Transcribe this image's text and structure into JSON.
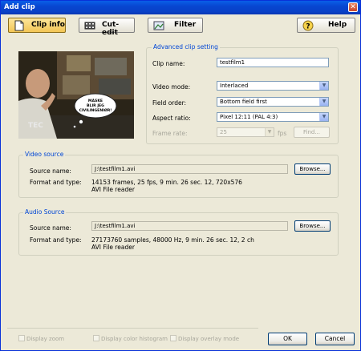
{
  "window": {
    "title": "Add clip"
  },
  "tabs": {
    "clip_info": "Clip info",
    "cut_edit": "Cut-edit",
    "filter": "Filter",
    "help": "Help"
  },
  "advanced": {
    "legend": "Advanced clip setting",
    "clip_name_label": "Clip name:",
    "clip_name_value": "testfilm1",
    "video_mode_label": "Video mode:",
    "video_mode_value": "Interlaced",
    "field_order_label": "Field order:",
    "field_order_value": "Bottom field first",
    "aspect_ratio_label": "Aspect ratio:",
    "aspect_ratio_value": "Pixel 12:11 (PAL 4:3)",
    "frame_rate_label": "Frame rate:",
    "frame_rate_value": "25",
    "fps_label": "fps",
    "find_label": "Find..."
  },
  "preview": {
    "bubble_text": "MÅSKE BLIR JEG CIVILINGENIØR!",
    "logo": "TEC"
  },
  "video_source": {
    "legend": "Video source",
    "source_name_label": "Source name:",
    "source_name_value": "J:\\testfilm1.avi",
    "browse_label": "Browse...",
    "format_label": "Format and type:",
    "format_line1": "14153 frames,  25 fps,  9 min. 26 sec. 12,  720x576",
    "format_line2": "AVI File reader"
  },
  "audio_source": {
    "legend": "Audio Source",
    "source_name_label": "Source name:",
    "source_name_value": "J:\\testfilm1.avi",
    "browse_label": "Browse...",
    "format_label": "Format and type:",
    "format_line1": "27173760 samples,  48000 Hz,  9 min. 26 sec. 12,  2 ch",
    "format_line2": "AVI File reader"
  },
  "footer": {
    "display_zoom": "Display zoom",
    "display_color_histogram": "Display color histogram",
    "display_overlay_mode": "Display overlay mode",
    "ok": "OK",
    "cancel": "Cancel"
  },
  "colors": {
    "title_blue": "#0846d0",
    "legend_blue": "#0046d5",
    "active_tab": "#f2c555"
  }
}
